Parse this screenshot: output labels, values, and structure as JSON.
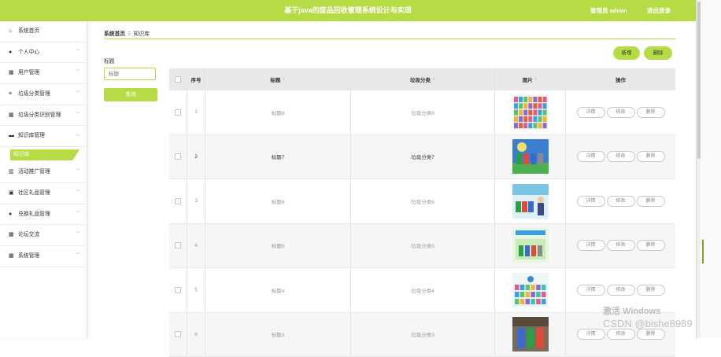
{
  "header": {
    "title": "基于java的废品回收管理系统设计与实现",
    "user_label": "管理员 admin",
    "logout_label": "退出登录"
  },
  "sidebar": {
    "items": [
      {
        "label": "系统首页",
        "icon": "home-icon",
        "glyph": "⌂",
        "has_chevron": false
      },
      {
        "label": "个人中心",
        "icon": "user-icon",
        "glyph": "●",
        "has_chevron": true
      },
      {
        "label": "用户管理",
        "icon": "grid-icon",
        "glyph": "▦",
        "has_chevron": true
      },
      {
        "label": "垃圾分类管理",
        "icon": "list-icon",
        "glyph": "≡",
        "has_chevron": true
      },
      {
        "label": "垃圾分类识别管理",
        "icon": "grid-icon",
        "glyph": "▦",
        "has_chevron": true
      },
      {
        "label": "知识库管理",
        "icon": "monitor-icon",
        "glyph": "▬",
        "has_chevron": true,
        "expanded": true
      }
    ],
    "active_sub": "知识库",
    "items_after": [
      {
        "label": "活动推广管理",
        "icon": "chart-icon",
        "glyph": "▥",
        "has_chevron": true
      },
      {
        "label": "社区礼品管理",
        "icon": "gift-icon",
        "glyph": "▣",
        "has_chevron": true
      },
      {
        "label": "兑换礼品管理",
        "icon": "user-icon",
        "glyph": "●",
        "has_chevron": true
      },
      {
        "label": "论坛交流",
        "icon": "grid-icon",
        "glyph": "▦",
        "has_chevron": true
      },
      {
        "label": "系统管理",
        "icon": "grid-icon",
        "glyph": "▦",
        "has_chevron": true
      }
    ]
  },
  "breadcrumb": {
    "home": "系统首页",
    "separator": "Ξ",
    "current": "知识库"
  },
  "filter": {
    "label": "标题",
    "placeholder": "标题",
    "search_label": "查询"
  },
  "toolbar": {
    "add_label": "新增",
    "delete_label": "删除"
  },
  "table": {
    "headers": {
      "index": "序号",
      "title": "标题",
      "category": "垃圾分类",
      "image": "图片",
      "actions": "操作"
    },
    "row_actions": {
      "detail": "详情",
      "edit": "修改",
      "delete": "删除"
    },
    "rows": [
      {
        "index": "1",
        "title": "标题8",
        "category": "垃圾分类8",
        "image": "poster-1"
      },
      {
        "index": "2",
        "title": "标题7",
        "category": "垃圾分类7",
        "image": "poster-2"
      },
      {
        "index": "3",
        "title": "标题6",
        "category": "垃圾分类6",
        "image": "poster-3"
      },
      {
        "index": "4",
        "title": "标题5",
        "category": "垃圾分类5",
        "image": "poster-4"
      },
      {
        "index": "5",
        "title": "标题4",
        "category": "垃圾分类4",
        "image": "poster-5"
      },
      {
        "index": "6",
        "title": "标题3",
        "category": "垃圾分类3",
        "image": "poster-6"
      }
    ]
  },
  "watermarks": {
    "windows": "激活 Windows",
    "csdn": "CSDN @bishe8989"
  },
  "colors": {
    "accent": "#b5dc44",
    "header_bg": "#b5dc44",
    "table_head": "#e8e8e8"
  }
}
